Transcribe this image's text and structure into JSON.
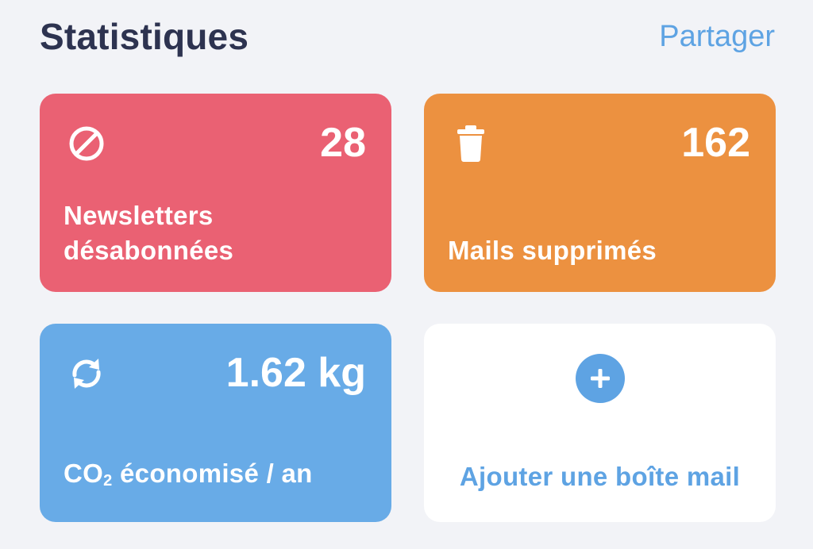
{
  "header": {
    "title": "Statistiques",
    "share_label": "Partager"
  },
  "cards": {
    "newsletters": {
      "icon": "blocked-icon",
      "value": "28",
      "label": "Newsletters désabonnées",
      "color": "#ea6173"
    },
    "deleted": {
      "icon": "trash-icon",
      "value": "162",
      "label": "Mails supprimés",
      "color": "#ec9140"
    },
    "co2": {
      "icon": "refresh-icon",
      "value": "1.62 kg",
      "label_prefix": "CO",
      "label_subscript": "2",
      "label_suffix": " économisé / an",
      "color": "#68abe7"
    },
    "add_mailbox": {
      "icon": "plus-circle-icon",
      "label": "Ajouter une boîte mail",
      "color": "#5ea3e3"
    }
  }
}
